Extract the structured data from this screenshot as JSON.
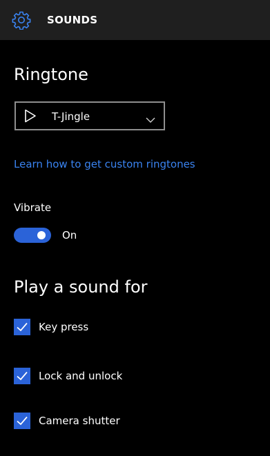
{
  "header": {
    "icon": "gear-icon",
    "title": "SOUNDS"
  },
  "ringtone": {
    "heading": "Ringtone",
    "selected": "T-Jingle",
    "play_icon": "play-icon",
    "chevron_icon": "chevron-down-icon"
  },
  "link": {
    "label": "Learn how to get custom ringtones"
  },
  "vibrate": {
    "label": "Vibrate",
    "state": "On",
    "enabled": true
  },
  "play_sound": {
    "heading": "Play a sound for",
    "options": [
      {
        "label": "Key press",
        "checked": true
      },
      {
        "label": "Lock and unlock",
        "checked": true
      },
      {
        "label": "Camera shutter",
        "checked": true
      }
    ]
  },
  "colors": {
    "accent": "#2b63d8",
    "link": "#3a83f0",
    "header_bg": "#1f1f1f",
    "background": "#000000"
  }
}
